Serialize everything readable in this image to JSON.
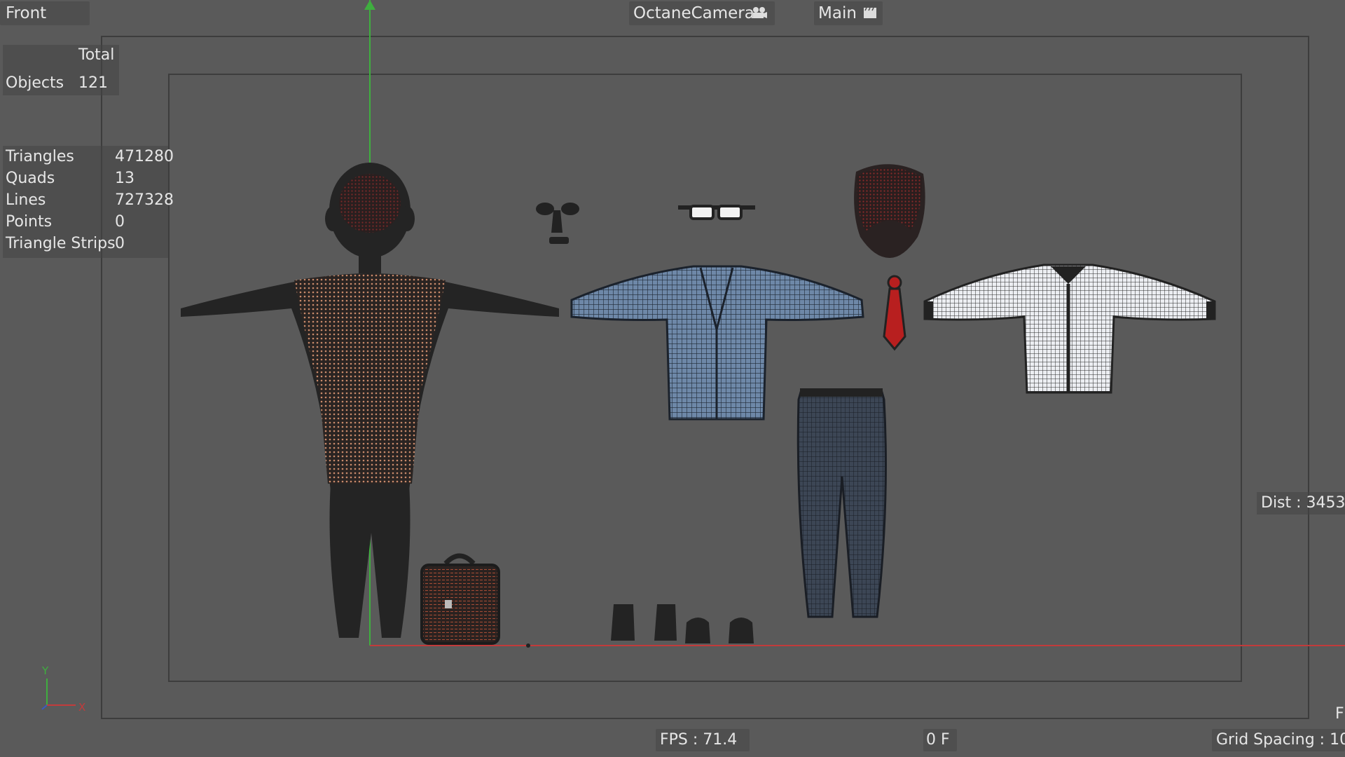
{
  "viewport": {
    "view_name": "Front",
    "camera_label": "OctaneCamera",
    "camera_icon": "camera-icon",
    "take_label": "Main",
    "take_icon": "clapperboard-icon",
    "dist_label": "Dist : 3453.",
    "fps_label": "FPS : 71.4",
    "frame_label": "0 F",
    "grid_label": "Grid Spacing : 10",
    "corner_letter": "F"
  },
  "stats": {
    "total_header": "Total",
    "objects": {
      "label": "Objects",
      "value": "121"
    },
    "rows": [
      {
        "label": "Triangles",
        "value": "471280"
      },
      {
        "label": "Quads",
        "value": "13"
      },
      {
        "label": "Lines",
        "value": "727328"
      },
      {
        "label": "Points",
        "value": "0"
      },
      {
        "label": "Triangle Strips",
        "value": "0"
      }
    ]
  },
  "axis_gizmo": {
    "y": "Y",
    "x": "X"
  },
  "colors": {
    "y_axis": "#3fae3f",
    "x_axis": "#c23b3b",
    "jacket": "#6b86a6",
    "shirt": "#e8eaee",
    "skin_wire": "#c98a6a",
    "hair_wire": "#8a2a2a",
    "tie": "#b81f1f"
  }
}
